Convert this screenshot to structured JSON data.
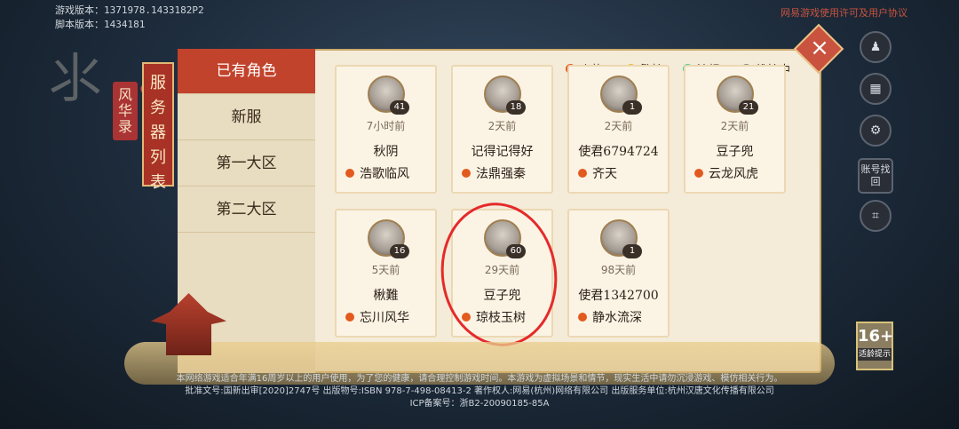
{
  "header": {
    "game_version_label": "游戏版本：1371978.1433182P2",
    "script_version_label": "脚本版本：1434181",
    "agreement_link": "网易游戏使用许可及用户协议"
  },
  "logo": {
    "subtitle": "风华录"
  },
  "sidebar": {
    "title": "服务器列表",
    "items": [
      {
        "label": "已有角色",
        "active": true
      },
      {
        "label": "新服",
        "active": false
      },
      {
        "label": "第一大区",
        "active": false
      },
      {
        "label": "第二大区",
        "active": false
      }
    ]
  },
  "legend": [
    {
      "label": "火热",
      "color": "#e35a1e"
    },
    {
      "label": "繁忙",
      "color": "#f2b53c"
    },
    {
      "label": "流畅",
      "color": "#4ccf8f"
    },
    {
      "label": "维护中",
      "color": "#8a8a8a"
    }
  ],
  "characters": [
    {
      "level": "41",
      "time": "7小时前",
      "name": "秋阴",
      "server": "浩歌临风",
      "status_color": "#e35a1e"
    },
    {
      "level": "18",
      "time": "2天前",
      "name": "记得记得好",
      "server": "法鼎强秦",
      "status_color": "#e35a1e"
    },
    {
      "level": "1",
      "time": "2天前",
      "name": "使君6794724",
      "server": "齐天",
      "status_color": "#e35a1e"
    },
    {
      "level": "21",
      "time": "2天前",
      "name": "豆子兜",
      "server": "云龙风虎",
      "status_color": "#e35a1e"
    },
    {
      "level": "16",
      "time": "5天前",
      "name": "楸難",
      "server": "忘川风华",
      "status_color": "#e35a1e"
    },
    {
      "level": "60",
      "time": "29天前",
      "name": "豆子兜",
      "server": "琼枝玉树",
      "status_color": "#e35a1e"
    },
    {
      "level": "1",
      "time": "98天前",
      "name": "使君1342700",
      "server": "静水流深",
      "status_color": "#e35a1e"
    }
  ],
  "side_buttons": {
    "account_recover": "账号找回"
  },
  "age_rating": {
    "number": "16+",
    "tip": "适龄提示"
  },
  "footer": {
    "line1": "本网络游戏适合年满16周岁以上的用户使用，为了您的健康，请合理控制游戏时间。本游戏为虚拟场景和情节，现实生活中请勿沉浸游戏、模仿相关行为。",
    "line2": "批准文号:国新出审[2020]2747号   出版物号:ISBN 978-7-498-08413-2   著作权人:网易(杭州)网络有限公司   出版服务单位:杭州汉唐文化传播有限公司",
    "line3": "ICP备案号：浙B2-20090185-85A"
  }
}
